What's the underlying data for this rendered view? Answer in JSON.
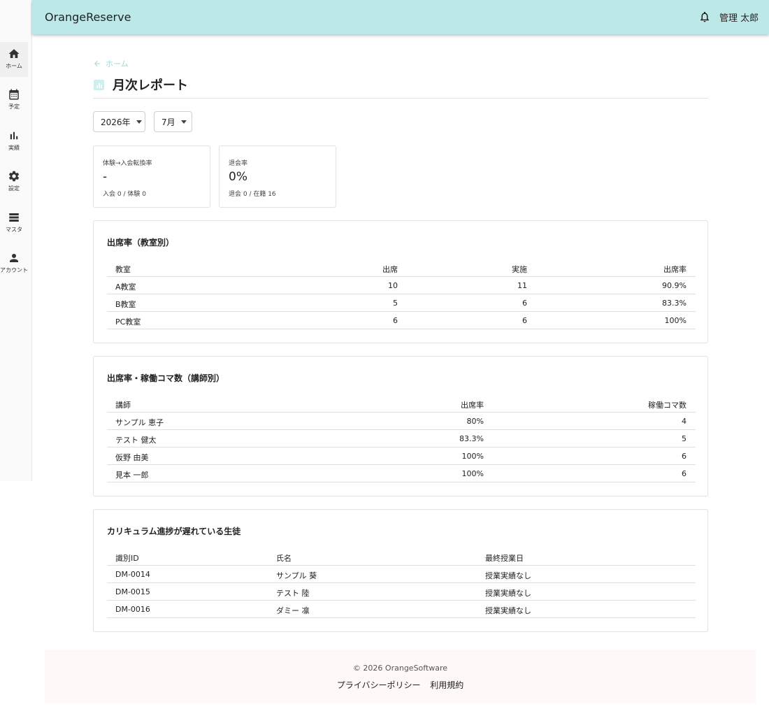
{
  "app": {
    "brand": "OrangeReserve"
  },
  "header": {
    "user_name": "管理 太郎"
  },
  "sidebar": {
    "items": [
      {
        "label": "ホーム",
        "icon": "home-icon"
      },
      {
        "label": "予定",
        "icon": "calendar-icon"
      },
      {
        "label": "実績",
        "icon": "bar-chart-icon"
      },
      {
        "label": "設定",
        "icon": "gear-icon"
      },
      {
        "label": "マスタ",
        "icon": "list-icon"
      },
      {
        "label": "アカウント",
        "icon": "person-icon"
      }
    ]
  },
  "breadcrumb": {
    "back_label": "ホーム"
  },
  "page": {
    "title": "月次レポート"
  },
  "filters": {
    "year": "2026年",
    "month": "7月"
  },
  "stats": [
    {
      "label": "体験→入会転換率",
      "value": "-",
      "sub": "入会 0 / 体験 0"
    },
    {
      "label": "退会率",
      "value": "0%",
      "sub": "退会 0 / 在籍 16"
    }
  ],
  "attendance_by_room": {
    "title": "出席率（教室別）",
    "headers": [
      "教室",
      "出席",
      "実施",
      "出席率"
    ],
    "rows": [
      [
        "A教室",
        "10",
        "11",
        "90.9%"
      ],
      [
        "B教室",
        "5",
        "6",
        "83.3%"
      ],
      [
        "PC教室",
        "6",
        "6",
        "100%"
      ]
    ]
  },
  "attendance_by_teacher": {
    "title": "出席率・稼働コマ数（講師別）",
    "headers": [
      "講師",
      "出席率",
      "稼働コマ数"
    ],
    "rows": [
      [
        "サンプル 恵子",
        "80%",
        "4"
      ],
      [
        "テスト 健太",
        "83.3%",
        "5"
      ],
      [
        "仮野 由美",
        "100%",
        "6"
      ],
      [
        "見本 一郎",
        "100%",
        "6"
      ]
    ]
  },
  "delayed_students": {
    "title": "カリキュラム進捗が遅れている生徒",
    "headers": [
      "識別ID",
      "氏名",
      "最終授業日"
    ],
    "rows": [
      [
        "DM-0014",
        "サンプル 葵",
        "授業実績なし"
      ],
      [
        "DM-0015",
        "テスト 陸",
        "授業実績なし"
      ],
      [
        "DM-0016",
        "ダミー 凛",
        "授業実績なし"
      ]
    ]
  },
  "footer": {
    "copyright": "© 2026 OrangeSoftware",
    "links": [
      "プライバシーポリシー",
      "利用規約"
    ]
  },
  "colors": {
    "header_bg": "#bde8e8",
    "accent": "#9fd8d8",
    "footer_bg": "#fff8f8"
  }
}
